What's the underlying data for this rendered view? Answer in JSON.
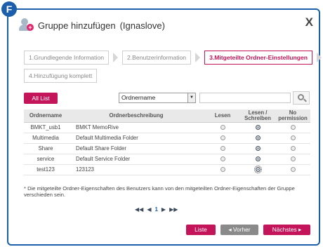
{
  "badge": "F",
  "dialog": {
    "title": "Gruppe hinzufügen",
    "subtitle": "(Ignaslove)",
    "close_label": "X"
  },
  "steps": [
    {
      "label": "1.Grundlegende Information",
      "active": false
    },
    {
      "label": "2.Benutzerinformation",
      "active": false
    },
    {
      "label": "3.Mitgeteilte Ordner-Einstellungen",
      "active": true
    },
    {
      "label": "4.Hinzufügung komplett",
      "active": false
    }
  ],
  "toolbar": {
    "all_list_label": "All List",
    "select_value": "Ordnername",
    "search_value": ""
  },
  "table": {
    "headers": {
      "name": "Ordnername",
      "desc": "Ordnerbeschreibung",
      "read": "Lesen",
      "read_write_1": "Lesen /",
      "read_write_2": "Schreiben",
      "no_perm_1": "No",
      "no_perm_2": "permission"
    },
    "rows": [
      {
        "name": "BMKT_usb1",
        "desc": "BMKT MemoRive",
        "perm": "rw"
      },
      {
        "name": "Multimedia",
        "desc": "Default Multimedia Folder",
        "perm": "rw"
      },
      {
        "name": "Share",
        "desc": "Default Share Folder",
        "perm": "rw"
      },
      {
        "name": "service",
        "desc": "Default Service Folder",
        "perm": "rw"
      },
      {
        "name": "test123",
        "desc": "123123",
        "perm": "rw"
      }
    ]
  },
  "note": "* Die mitgeteilte Ordner-Eigenschaften des Benutzers kann von den mitgeteilten Ordner-Eigenschaften der Gruppe verschieden sein.",
  "pager": {
    "first": "◀◀",
    "prev": "◀",
    "current": "1",
    "next": "▶",
    "last": "▶▶"
  },
  "buttons": {
    "liste": "Liste",
    "prev": "◂ Vorher",
    "next": "Nächstes ▸"
  },
  "colors": {
    "accent": "#c4145a",
    "frame": "#1b5eab"
  }
}
